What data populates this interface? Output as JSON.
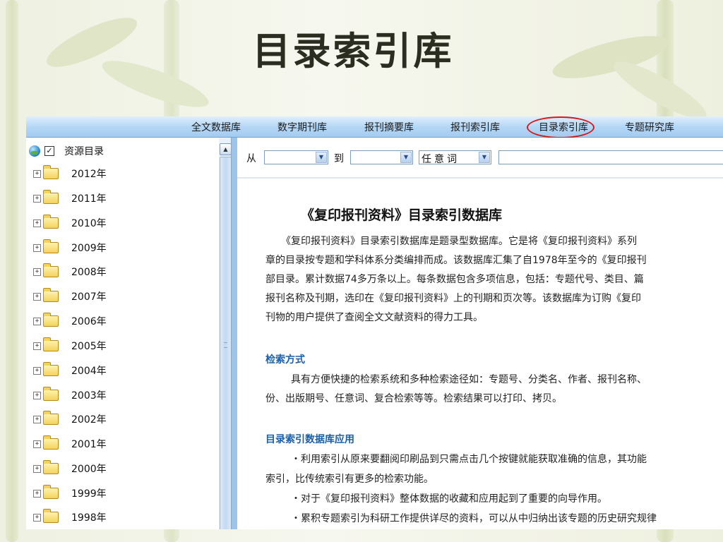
{
  "slide": {
    "title": "目录索引库"
  },
  "nav": {
    "items": [
      "全文数据库",
      "数字期刊库",
      "报刊摘要库",
      "报刊索引库",
      "目录索引库",
      "专题研究库"
    ],
    "highlighted": "目录索引库"
  },
  "sidebar": {
    "root_label": "资源目录",
    "root_checked": "✓",
    "years": [
      "2012年",
      "2011年",
      "2010年",
      "2009年",
      "2008年",
      "2007年",
      "2006年",
      "2005年",
      "2004年",
      "2003年",
      "2002年",
      "2001年",
      "2000年",
      "1999年",
      "1998年"
    ]
  },
  "search": {
    "from_label": "从",
    "to_label": "到",
    "from_value": "",
    "to_value": "",
    "field_value": "任意词",
    "query_value": ""
  },
  "content": {
    "title": "《复印报刊资料》目录索引数据库",
    "intro_lines": [
      "《复印报刊资料》目录索引数据库是题录型数据库。它是将《复印报刊资料》系列",
      "章的目录按专题和学科体系分类编排而成。该数据库汇集了自1978年至今的《复印报刊",
      "部目录。累计数据74多万条以上。每条数据包含多项信息，包括：专题代号、类目、篇",
      "报刊名称及刊期，选印在《复印报刊资料》上的刊期和页次等。该数据库为订购《复印",
      "刊物的用户提供了查阅全文文献资料的得力工具。"
    ],
    "sections": [
      {
        "heading": "检索方式",
        "lines": [
          "具有方便快捷的检索系统和多种检索途径如：专题号、分类名、作者、报刊名称、",
          "份、出版期号、任意词、复合检索等等。检索结果可以打印、拷贝。"
        ]
      },
      {
        "heading": "目录索引数据库应用",
        "lines": [
          "・利用索引从原来要翻阅印刷品到只需点击几个按键就能获取准确的信息，其功能",
          "索引，比传统索引有更多的检索功能。",
          "・对于《复印报刊资料》整体数据的收藏和应用起到了重要的向导作用。",
          "・累积专题索引为科研工作提供详尽的资料，可以从中归纳出该专题的历史研究规律"
        ]
      }
    ]
  },
  "colors": {
    "nav_bg": "#b5d7f5",
    "highlight_circle": "#d21a1a",
    "section_heading": "#1c5fa8",
    "background": "#f6f7ee"
  }
}
